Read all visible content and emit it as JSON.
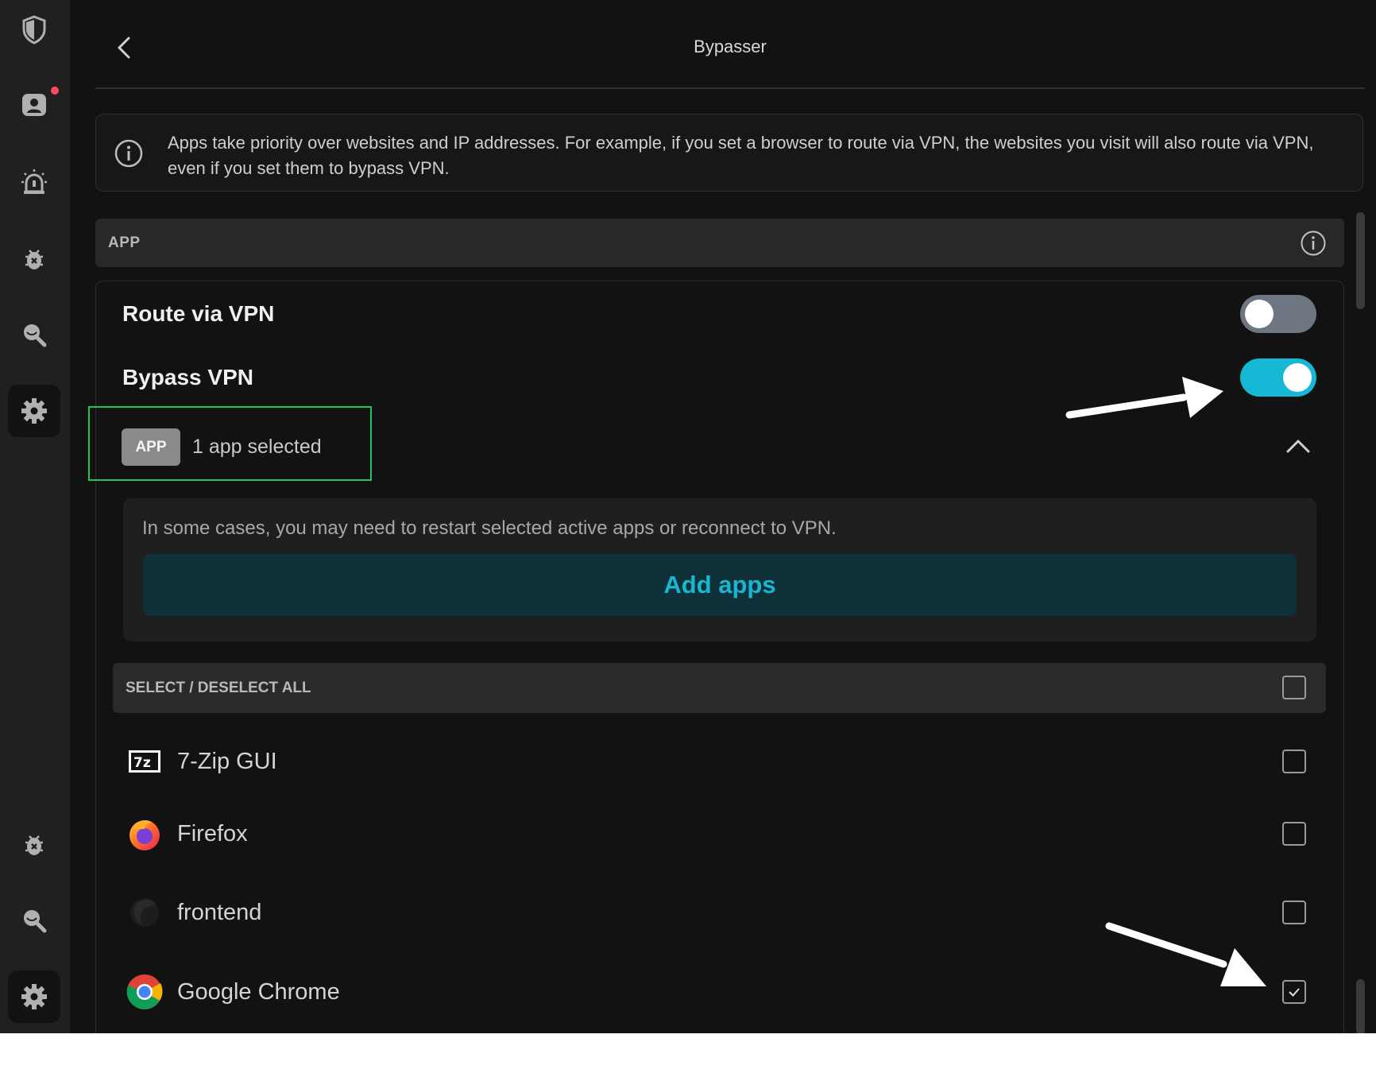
{
  "header": {
    "title": "Bypasser"
  },
  "info_banner": {
    "text": "Apps take priority over websites and IP addresses. For example, if you set a browser to route via VPN, the websites you visit will also route via VPN, even if you set them to bypass VPN."
  },
  "section": {
    "label": "APP"
  },
  "route_via_vpn": {
    "label": "Route via VPN",
    "enabled": false
  },
  "bypass_vpn": {
    "label": "Bypass VPN",
    "enabled": true
  },
  "selection": {
    "badge": "APP",
    "count_text": "1 app selected"
  },
  "notice": {
    "text": "In some cases, you may need to restart selected active apps or reconnect to VPN.",
    "button_label": "Add apps"
  },
  "select_all": {
    "label": "SELECT / DESELECT ALL",
    "checked": false
  },
  "apps": [
    {
      "name": "7-Zip GUI",
      "icon": "7zip-icon",
      "checked": false
    },
    {
      "name": "Firefox",
      "icon": "firefox-icon",
      "checked": false
    },
    {
      "name": "frontend",
      "icon": "frontend-app-icon",
      "checked": false
    },
    {
      "name": "Google Chrome",
      "icon": "chrome-icon",
      "checked": true
    }
  ],
  "colors": {
    "accent": "#17b8d6",
    "highlight_box": "#22c55e",
    "background": "#121212",
    "sidebar": "#202020"
  }
}
